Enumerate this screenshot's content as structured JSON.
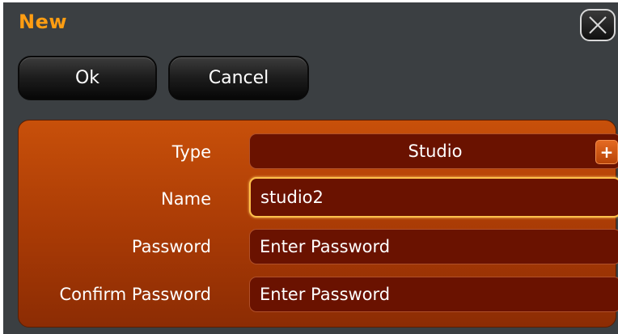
{
  "dialog": {
    "title": "New",
    "close_icon": "close-icon"
  },
  "toolbar": {
    "ok_label": "Ok",
    "cancel_label": "Cancel"
  },
  "form": {
    "type": {
      "label": "Type",
      "value": "Studio",
      "add_label": "+"
    },
    "name": {
      "label": "Name",
      "value": "studio2"
    },
    "password": {
      "label": "Password",
      "placeholder": "Enter Password",
      "value": ""
    },
    "confirm_password": {
      "label": "Confirm Password",
      "placeholder": "Enter Password",
      "value": ""
    }
  },
  "colors": {
    "title": "#ff9d12",
    "background": "#3b3f42",
    "panel": "#b4420a",
    "field": "#6a1200",
    "focus_border": "#ffc04a"
  }
}
